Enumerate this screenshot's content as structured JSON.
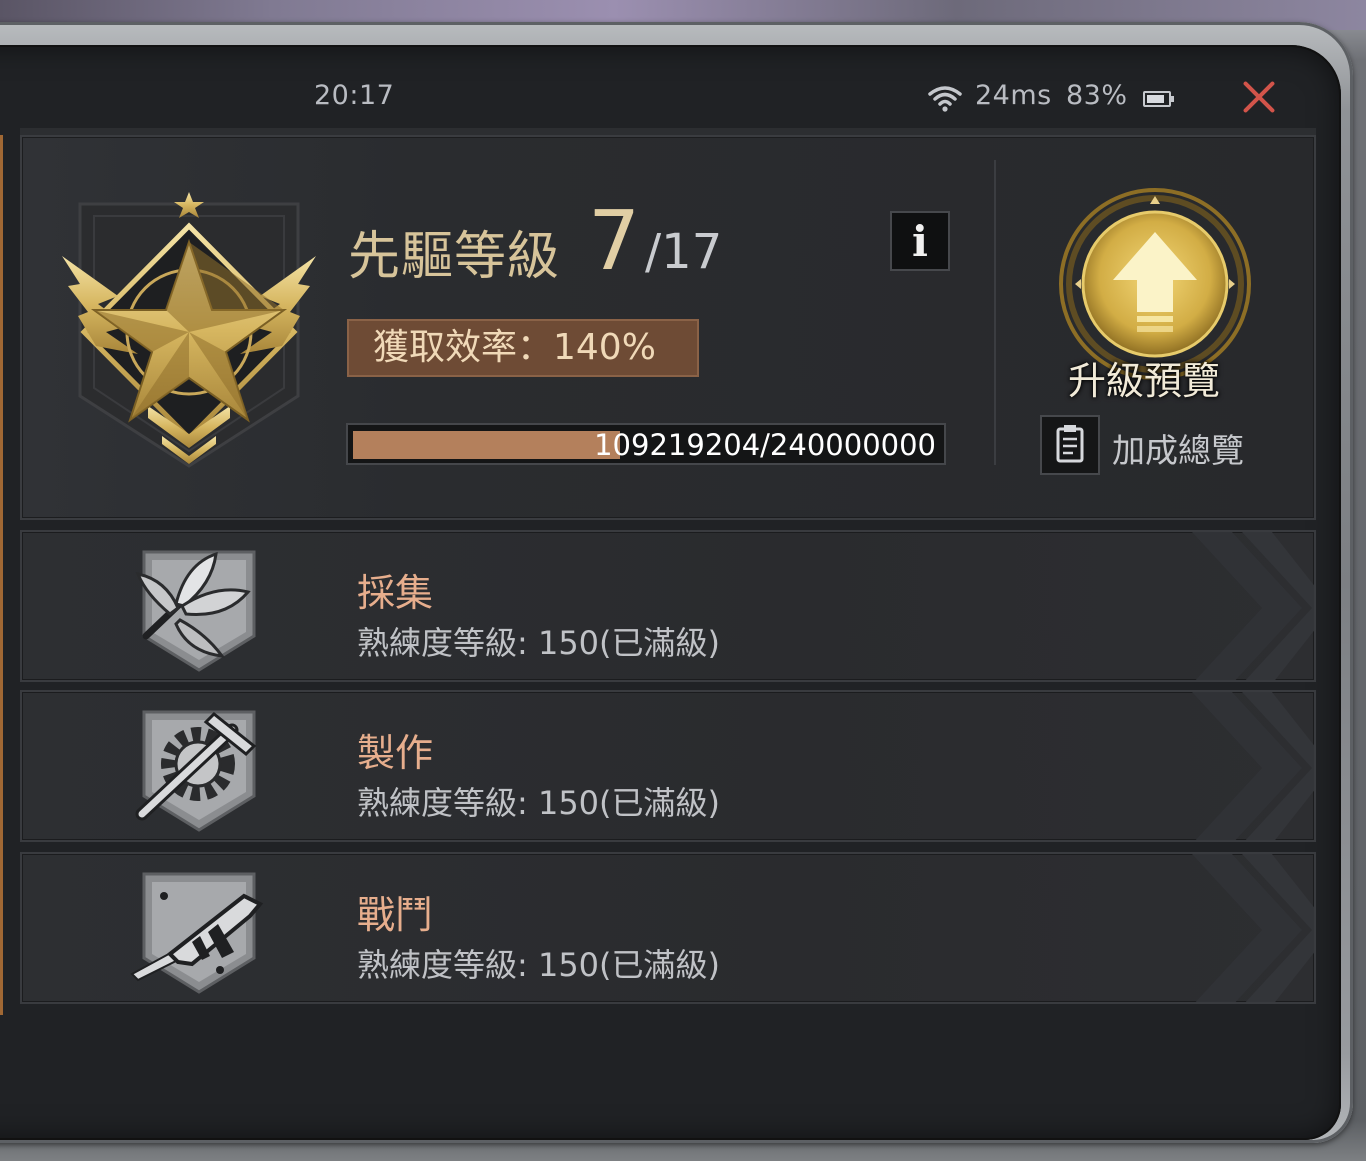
{
  "status_bar": {
    "time": "20:17",
    "ping": "24ms",
    "battery": "83%",
    "icons": [
      "wifi-icon",
      "battery-icon"
    ]
  },
  "header": {
    "close_icon": "close-icon"
  },
  "pioneer": {
    "title": "先驅等級",
    "level": "7",
    "max_level": "/17",
    "efficiency": "獲取效率：140%",
    "progress_text": "109219204/240000000",
    "progress_value": 109219204,
    "progress_max": 240000000,
    "info_label": "i",
    "upgrade_preview": "升級預覽",
    "bonus_overview": "加成總覽"
  },
  "skills": [
    {
      "name": "採集",
      "level": "熟練度等級: 150(已滿級)",
      "icon": "herb-icon"
    },
    {
      "name": "製作",
      "level": "熟練度等級: 150(已滿級)",
      "icon": "gear-hammer-icon"
    },
    {
      "name": "戰鬥",
      "level": "熟練度等級: 150(已滿級)",
      "icon": "gun-icon"
    }
  ],
  "colors": {
    "accent_gold": "#d7c49a",
    "efficiency_bg": "#6e4b35",
    "progress_fill": "#b4805c",
    "skill_name": "#e7ae8d",
    "close": "#d2544a"
  }
}
